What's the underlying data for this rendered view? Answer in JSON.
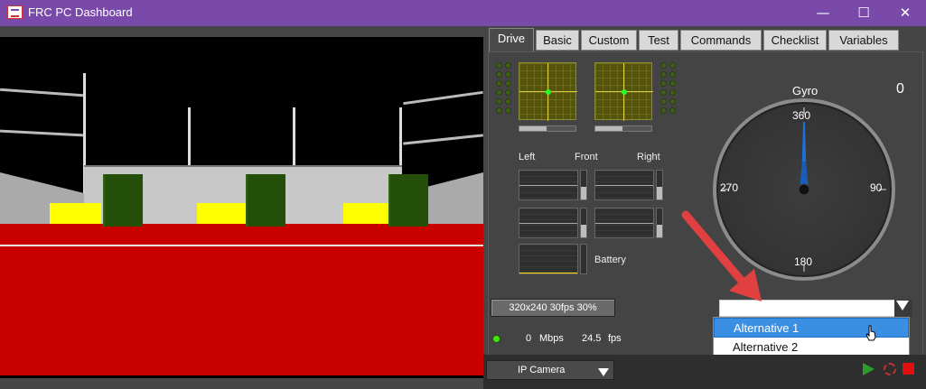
{
  "window": {
    "title": "FRC PC Dashboard",
    "minimize": "—",
    "maximize": "☐",
    "close": "✕"
  },
  "tabs": [
    {
      "label": "Drive",
      "active": true
    },
    {
      "label": "Basic"
    },
    {
      "label": "Custom"
    },
    {
      "label": "Test"
    },
    {
      "label": "Commands"
    },
    {
      "label": "Checklist"
    },
    {
      "label": "Variables"
    }
  ],
  "drive": {
    "labels": {
      "left": "Left",
      "front": "Front",
      "right": "Right",
      "battery": "Battery"
    },
    "gyro": {
      "title": "Gyro",
      "value": "0",
      "ticks": {
        "n": "360",
        "e": "90",
        "s": "180",
        "w": "270"
      }
    },
    "resolution_button": "320x240   30fps   30%",
    "status": {
      "mbps_value": "0",
      "mbps_unit": "Mbps",
      "fps_value": "24.5",
      "fps_unit": "fps"
    },
    "chooser": {
      "selected": "",
      "options": [
        "Alternative 1",
        "Alternative 2"
      ],
      "highlighted": "Alternative 1"
    }
  },
  "camera": {
    "source": "IP Camera"
  },
  "colors": {
    "title_bar": "#7a4aab",
    "highlight": "#3b8fe3",
    "arrow": "#e04040"
  },
  "icons": [
    "play-icon",
    "record-icon",
    "stop-icon",
    "pointer-cursor-icon",
    "red-arrow-icon"
  ]
}
